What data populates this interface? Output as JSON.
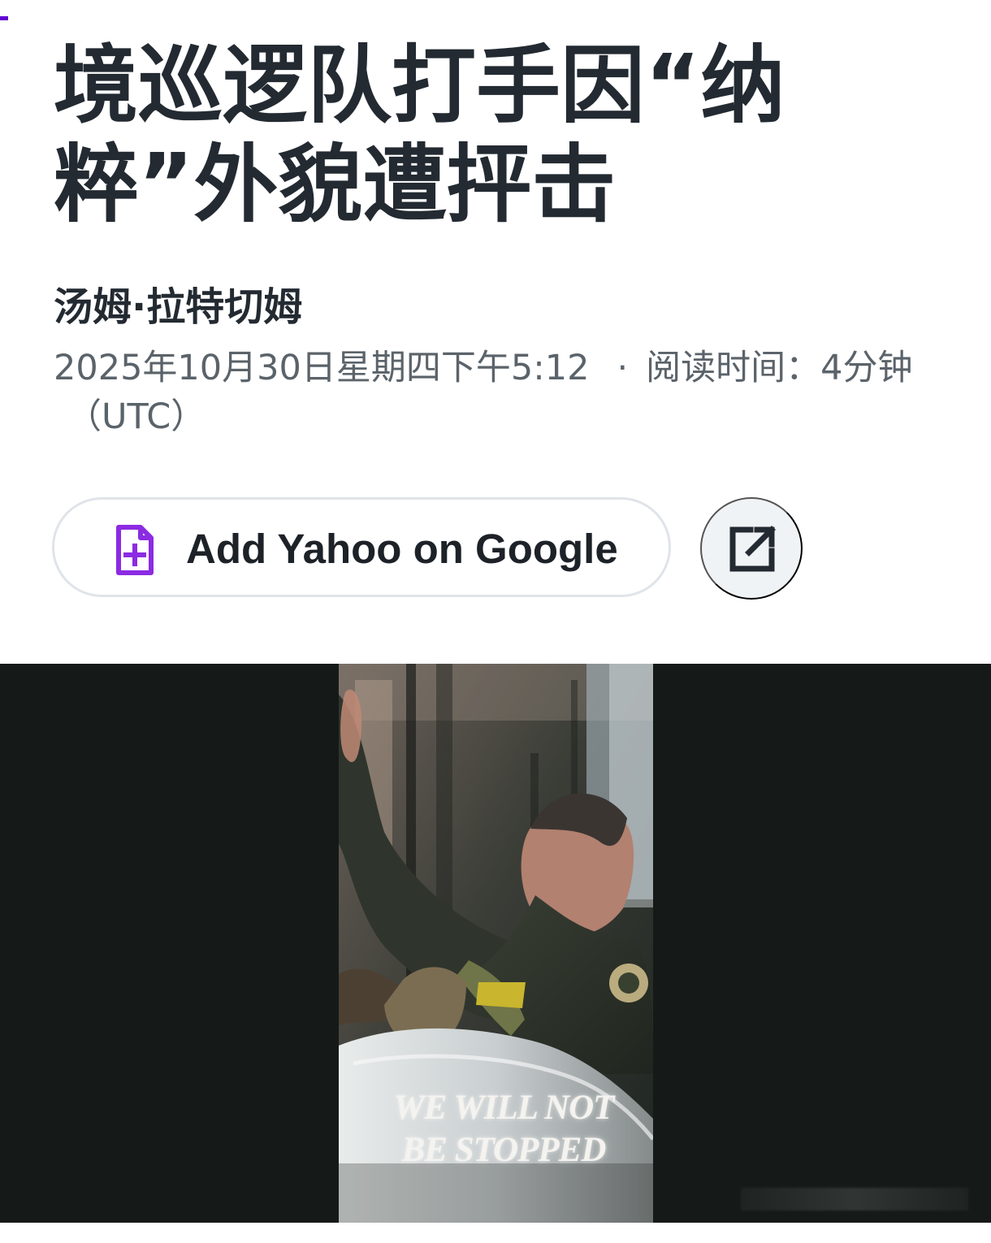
{
  "article": {
    "title": "境巡逻队打手因“纳粹”外貌遭抨击",
    "author": "汤姆·拉特切姆",
    "published": "2025年10月30日星期四下午5:12",
    "separator": "·",
    "reading_time": "阅读时间：4分钟",
    "timezone": "（UTC）"
  },
  "actions": {
    "add_google_label": "Add Yahoo on Google",
    "add_google_icon": "document-plus-icon",
    "share_icon": "external-link-icon"
  },
  "media": {
    "caption": "WE WILL NOT BE STOPPED"
  },
  "colors": {
    "accent": "#6001d2",
    "text": "#232a31",
    "muted": "#5b636a",
    "button_border": "#e0e4e9",
    "share_bg": "#f0f3f5",
    "video_bg": "#151a18"
  }
}
